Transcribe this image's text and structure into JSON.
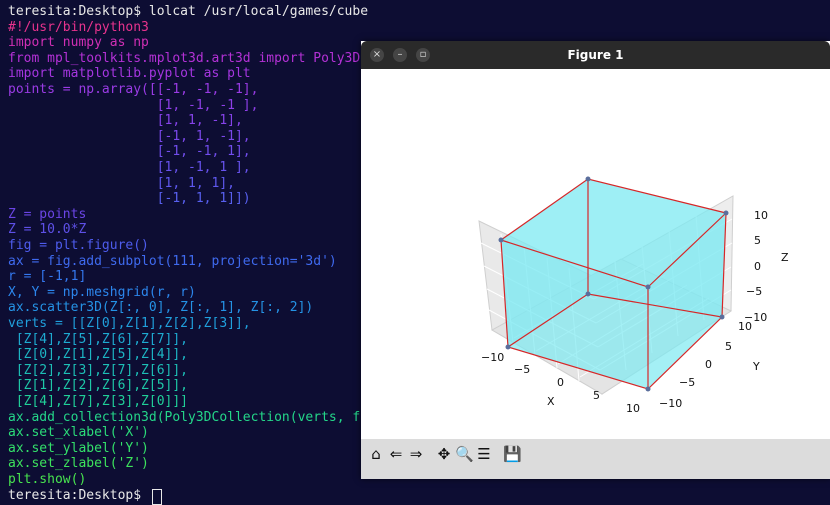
{
  "terminal": {
    "lines": [
      {
        "text": "teresita:Desktop$ lolcat /usr/local/games/cube",
        "color": "#e8e8e8"
      },
      {
        "text": "#!/usr/bin/python3",
        "color": "#e8338d"
      },
      {
        "text": "import numpy as np",
        "color": "#d02fb4"
      },
      {
        "text": "from mpl_toolkits.mplot3d.art3d import Poly3D",
        "color": "#b431d6"
      },
      {
        "text": "import matplotlib.pyplot as plt",
        "color": "#a536e0"
      },
      {
        "text": "points = np.array([[-1, -1, -1],",
        "color": "#9a3be5"
      },
      {
        "text": "                   [1, -1, -1 ],",
        "color": "#8f3fe8"
      },
      {
        "text": "                   [1, 1, -1],",
        "color": "#8643ea"
      },
      {
        "text": "                   [-1, 1, -1],",
        "color": "#7c48ec"
      },
      {
        "text": "                   [-1, -1, 1],",
        "color": "#724eee"
      },
      {
        "text": "                   [1, -1, 1 ],",
        "color": "#6853ef"
      },
      {
        "text": "                   [1, 1, 1],",
        "color": "#5f59f0"
      },
      {
        "text": "                   [-1, 1, 1]])",
        "color": "#5860f0"
      },
      {
        "text": "Z = points",
        "color": "#6b45e6"
      },
      {
        "text": "Z = 10.0*Z",
        "color": "#5e50e8"
      },
      {
        "text": "fig = plt.figure()",
        "color": "#4e5ced"
      },
      {
        "text": "ax = fig.add_subplot(111, projection='3d')",
        "color": "#3f6aef"
      },
      {
        "text": "r = [-1,1]",
        "color": "#3478ef"
      },
      {
        "text": "X, Y = np.meshgrid(r, r)",
        "color": "#2c86ec"
      },
      {
        "text": "ax.scatter3D(Z[:, 0], Z[:, 1], Z[:, 2])",
        "color": "#2593e5"
      },
      {
        "text": "verts = [[Z[0],Z[1],Z[2],Z[3]],",
        "color": "#20a0dc"
      },
      {
        "text": " [Z[4],Z[5],Z[6],Z[7]],",
        "color": "#1eabd1"
      },
      {
        "text": " [Z[0],Z[1],Z[5],Z[4]],",
        "color": "#1db6c4"
      },
      {
        "text": " [Z[2],Z[3],Z[7],Z[6]],",
        "color": "#1dbfb6"
      },
      {
        "text": " [Z[1],Z[2],Z[6],Z[5]],",
        "color": "#1ec8a7"
      },
      {
        "text": " [Z[4],Z[7],Z[3],Z[0]]]",
        "color": "#20cf98"
      },
      {
        "text": "ax.add_collection3d(Poly3DCollection(verts, f",
        "color": "#24d689"
      },
      {
        "text": "ax.set_xlabel('X')",
        "color": "#2bdc79"
      },
      {
        "text": "ax.set_ylabel('Y')",
        "color": "#33e06a"
      },
      {
        "text": "ax.set_zlabel('Z')",
        "color": "#3de35c"
      },
      {
        "text": "plt.show()",
        "color": "#48e44f"
      },
      {
        "text": "teresita:Desktop$ ",
        "color": "#e8e8e8"
      }
    ]
  },
  "window": {
    "title": "Figure 1",
    "close_glyph": "×",
    "minimize_glyph": "–",
    "maximize_glyph": "▫"
  },
  "plot": {
    "x_label": "X",
    "y_label": "Y",
    "z_label": "Z",
    "x_ticks": [
      "−10",
      "−5",
      "0",
      "5",
      "10"
    ],
    "y_ticks": [
      "−10",
      "−5",
      "0",
      "5",
      "10"
    ],
    "z_ticks": [
      "10",
      "5",
      "0",
      "−5",
      "−10"
    ],
    "face_color": "#7eeaf2",
    "edge_color": "#d62728",
    "point_color": "#5a6e9c"
  },
  "toolbar": {
    "buttons": [
      {
        "name": "home-icon",
        "glyph": "⌂"
      },
      {
        "name": "back-icon",
        "glyph": "⇐"
      },
      {
        "name": "forward-icon",
        "glyph": "⇒"
      },
      {
        "name": "pan-icon",
        "glyph": "✥"
      },
      {
        "name": "zoom-icon",
        "glyph": "🔍"
      },
      {
        "name": "configure-icon",
        "glyph": "☰"
      },
      {
        "name": "save-icon",
        "glyph": "💾"
      }
    ]
  }
}
